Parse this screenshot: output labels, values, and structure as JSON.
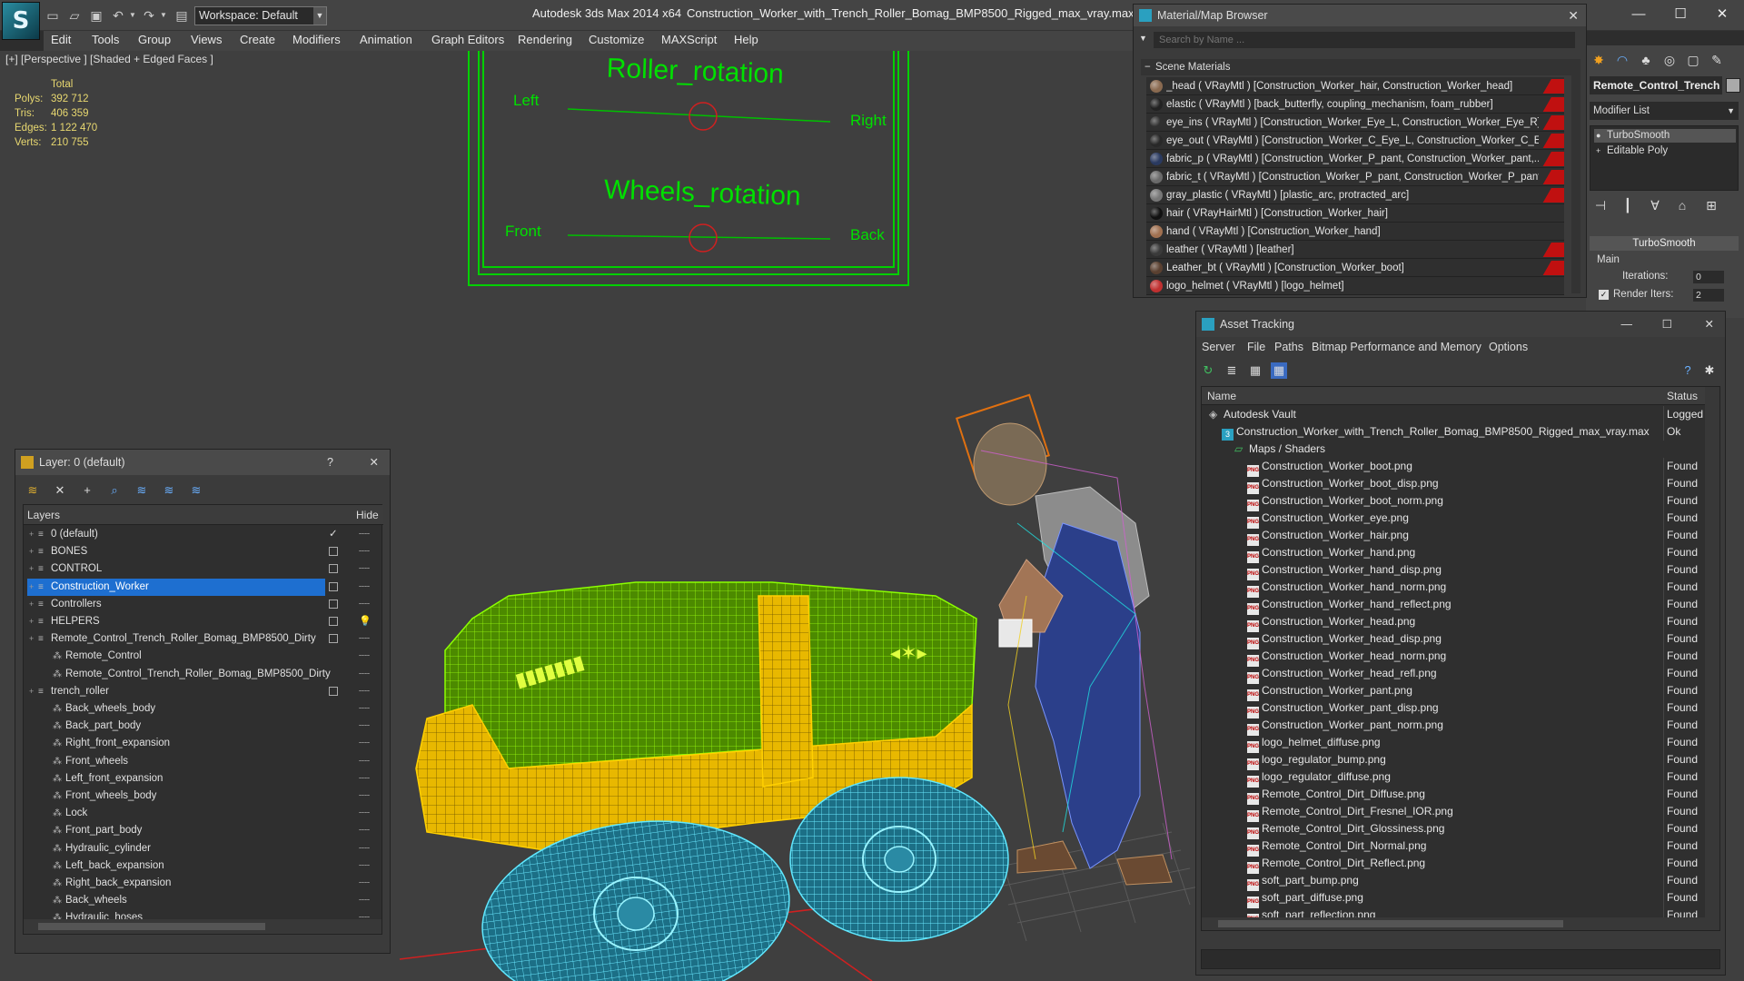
{
  "app": {
    "logo_glyph": "S",
    "title": "Autodesk 3ds Max  2014 x64",
    "file_title": "Construction_Worker_with_Trench_Roller_Bomag_BMP8500_Rigged_max_vray.max",
    "workspace": "Workspace: Default"
  },
  "menu": [
    "Edit",
    "Tools",
    "Group",
    "Views",
    "Create",
    "Modifiers",
    "Animation",
    "Graph Editors",
    "Rendering",
    "Customize",
    "MAXScript",
    "Help"
  ],
  "viewport": {
    "label": "[+] [Perspective ] [Shaded + Edged Faces ]",
    "stats": {
      "header": "Total",
      "rows": [
        {
          "k": "Polys:",
          "v": "392 712"
        },
        {
          "k": "Tris:",
          "v": "406 359"
        },
        {
          "k": "Edges:",
          "v": "1 122 470"
        },
        {
          "k": "Verts:",
          "v": "210 755"
        }
      ]
    },
    "controls": {
      "roller_title": "Roller_rotation",
      "roller_left": "Left",
      "roller_right": "Right",
      "wheels_title": "Wheels_rotation",
      "wheels_front": "Front",
      "wheels_back": "Back"
    }
  },
  "material_browser": {
    "title": "Material/Map Browser",
    "search_placeholder": "Search by Name ...",
    "section": "Scene Materials",
    "items": [
      {
        "text": "_head  ( VRayMtl ) [Construction_Worker_hair, Construction_Worker_head]",
        "color": "#8a6a50",
        "red": true
      },
      {
        "text": "elastic  ( VRayMtl ) [back_butterfly, coupling_mechanism, foam_rubber]",
        "color": "#222222",
        "red": true
      },
      {
        "text": "eye_ins  ( VRayMtl ) [Construction_Worker_Eye_L, Construction_Worker_Eye_R]",
        "color": "#303030",
        "red": true
      },
      {
        "text": "eye_out  ( VRayMtl ) [Construction_Worker_C_Eye_L, Construction_Worker_C_Ey...",
        "color": "#282828",
        "red": true
      },
      {
        "text": "fabric_p  ( VRayMtl ) [Construction_Worker_P_pant, Construction_Worker_pant,...",
        "color": "#2a3a60",
        "red": true
      },
      {
        "text": "fabric_t  ( VRayMtl ) [Construction_Worker_P_pant, Construction_Worker_P_pant...",
        "color": "#6a6a6a",
        "red": true
      },
      {
        "text": "gray_plastic  ( VRayMtl ) [plastic_arc, protracted_arc]",
        "color": "#777777",
        "red": true
      },
      {
        "text": "hair  ( VRayHairMtl ) [Construction_Worker_hair]",
        "color": "#111111",
        "red": false
      },
      {
        "text": "hand  ( VRayMtl ) [Construction_Worker_hand]",
        "color": "#a07050",
        "red": false
      },
      {
        "text": "leather  ( VRayMtl ) [leather]",
        "color": "#3a3a3a",
        "red": true
      },
      {
        "text": "Leather_bt  ( VRayMtl ) [Construction_Worker_boot]",
        "color": "#5a4030",
        "red": true
      },
      {
        "text": "logo_helmet  ( VRayMtl ) [logo_helmet]",
        "color": "#c03030",
        "red": false
      }
    ]
  },
  "command_panel": {
    "object_name": "Remote_Control_Trench",
    "modifier_list": "Modifier List",
    "stack": [
      "TurboSmooth",
      "Editable Poly"
    ],
    "rollout": "TurboSmooth",
    "main_label": "Main",
    "iterations_label": "Iterations:",
    "iterations_value": "0",
    "render_iters_label": "Render Iters:",
    "render_iters_value": "2"
  },
  "asset_tracking": {
    "title": "Asset Tracking",
    "menu": [
      "Server",
      "File",
      "Paths",
      "Bitmap Performance and Memory",
      "Options"
    ],
    "col_name": "Name",
    "col_status": "Status",
    "rows": [
      {
        "name": "Autodesk Vault",
        "status": "Logged",
        "indent": 0,
        "kind": "vault"
      },
      {
        "name": "Construction_Worker_with_Trench_Roller_Bomag_BMP8500_Rigged_max_vray.max",
        "status": "Ok",
        "indent": 1,
        "kind": "max"
      },
      {
        "name": "Maps / Shaders",
        "status": "",
        "indent": 2,
        "kind": "folder"
      },
      {
        "name": "Construction_Worker_boot.png",
        "status": "Found",
        "indent": 3,
        "kind": "png"
      },
      {
        "name": "Construction_Worker_boot_disp.png",
        "status": "Found",
        "indent": 3,
        "kind": "png"
      },
      {
        "name": "Construction_Worker_boot_norm.png",
        "status": "Found",
        "indent": 3,
        "kind": "png"
      },
      {
        "name": "Construction_Worker_eye.png",
        "status": "Found",
        "indent": 3,
        "kind": "png"
      },
      {
        "name": "Construction_Worker_hair.png",
        "status": "Found",
        "indent": 3,
        "kind": "png"
      },
      {
        "name": "Construction_Worker_hand.png",
        "status": "Found",
        "indent": 3,
        "kind": "png"
      },
      {
        "name": "Construction_Worker_hand_disp.png",
        "status": "Found",
        "indent": 3,
        "kind": "png"
      },
      {
        "name": "Construction_Worker_hand_norm.png",
        "status": "Found",
        "indent": 3,
        "kind": "png"
      },
      {
        "name": "Construction_Worker_hand_reflect.png",
        "status": "Found",
        "indent": 3,
        "kind": "png"
      },
      {
        "name": "Construction_Worker_head.png",
        "status": "Found",
        "indent": 3,
        "kind": "png"
      },
      {
        "name": "Construction_Worker_head_disp.png",
        "status": "Found",
        "indent": 3,
        "kind": "png"
      },
      {
        "name": "Construction_Worker_head_norm.png",
        "status": "Found",
        "indent": 3,
        "kind": "png"
      },
      {
        "name": "Construction_Worker_head_refl.png",
        "status": "Found",
        "indent": 3,
        "kind": "png"
      },
      {
        "name": "Construction_Worker_pant.png",
        "status": "Found",
        "indent": 3,
        "kind": "png"
      },
      {
        "name": "Construction_Worker_pant_disp.png",
        "status": "Found",
        "indent": 3,
        "kind": "png"
      },
      {
        "name": "Construction_Worker_pant_norm.png",
        "status": "Found",
        "indent": 3,
        "kind": "png"
      },
      {
        "name": "logo_helmet_diffuse.png",
        "status": "Found",
        "indent": 3,
        "kind": "png"
      },
      {
        "name": "logo_regulator_bump.png",
        "status": "Found",
        "indent": 3,
        "kind": "png"
      },
      {
        "name": "logo_regulator_diffuse.png",
        "status": "Found",
        "indent": 3,
        "kind": "png"
      },
      {
        "name": "Remote_Control_Dirt_Diffuse.png",
        "status": "Found",
        "indent": 3,
        "kind": "png"
      },
      {
        "name": "Remote_Control_Dirt_Fresnel_IOR.png",
        "status": "Found",
        "indent": 3,
        "kind": "png"
      },
      {
        "name": "Remote_Control_Dirt_Glossiness.png",
        "status": "Found",
        "indent": 3,
        "kind": "png"
      },
      {
        "name": "Remote_Control_Dirt_Normal.png",
        "status": "Found",
        "indent": 3,
        "kind": "png"
      },
      {
        "name": "Remote_Control_Dirt_Reflect.png",
        "status": "Found",
        "indent": 3,
        "kind": "png"
      },
      {
        "name": "soft_part_bump.png",
        "status": "Found",
        "indent": 3,
        "kind": "png"
      },
      {
        "name": "soft_part_diffuse.png",
        "status": "Found",
        "indent": 3,
        "kind": "png"
      },
      {
        "name": "soft_part_reflection.png",
        "status": "Found",
        "indent": 3,
        "kind": "png"
      }
    ]
  },
  "layer_explorer": {
    "title": "Layer: 0 (default)",
    "help": "?",
    "col_layers": "Layers",
    "col_hide": "Hide",
    "rows": [
      {
        "name": "0 (default)",
        "indent": 0,
        "kind": "layer",
        "check": "tick",
        "selected": false
      },
      {
        "name": "BONES",
        "indent": 0,
        "kind": "layer",
        "check": "box",
        "selected": false
      },
      {
        "name": "CONTROL",
        "indent": 0,
        "kind": "layer",
        "check": "box",
        "selected": false
      },
      {
        "name": "Construction_Worker",
        "indent": 0,
        "kind": "layer",
        "check": "box",
        "selected": true
      },
      {
        "name": "Controllers",
        "indent": 0,
        "kind": "layer",
        "check": "box",
        "selected": false
      },
      {
        "name": "HELPERS",
        "indent": 0,
        "kind": "layer",
        "check": "box",
        "selected": false,
        "bulb": true
      },
      {
        "name": "Remote_Control_Trench_Roller_Bomag_BMP8500_Dirty",
        "indent": 0,
        "kind": "layer",
        "check": "box",
        "selected": false
      },
      {
        "name": "Remote_Control",
        "indent": 1,
        "kind": "object",
        "check": "",
        "selected": false
      },
      {
        "name": "Remote_Control_Trench_Roller_Bomag_BMP8500_Dirty",
        "indent": 1,
        "kind": "object",
        "check": "",
        "selected": false
      },
      {
        "name": "trench_roller",
        "indent": 0,
        "kind": "layer",
        "check": "box",
        "selected": false
      },
      {
        "name": "Back_wheels_body",
        "indent": 1,
        "kind": "object",
        "check": "",
        "selected": false
      },
      {
        "name": "Back_part_body",
        "indent": 1,
        "kind": "object",
        "check": "",
        "selected": false
      },
      {
        "name": "Right_front_expansion",
        "indent": 1,
        "kind": "object",
        "check": "",
        "selected": false
      },
      {
        "name": "Front_wheels",
        "indent": 1,
        "kind": "object",
        "check": "",
        "selected": false
      },
      {
        "name": "Left_front_expansion",
        "indent": 1,
        "kind": "object",
        "check": "",
        "selected": false
      },
      {
        "name": "Front_wheels_body",
        "indent": 1,
        "kind": "object",
        "check": "",
        "selected": false
      },
      {
        "name": "Lock",
        "indent": 1,
        "kind": "object",
        "check": "",
        "selected": false
      },
      {
        "name": "Front_part_body",
        "indent": 1,
        "kind": "object",
        "check": "",
        "selected": false
      },
      {
        "name": "Hydraulic_cylinder",
        "indent": 1,
        "kind": "object",
        "check": "",
        "selected": false
      },
      {
        "name": "Left_back_expansion",
        "indent": 1,
        "kind": "object",
        "check": "",
        "selected": false
      },
      {
        "name": "Right_back_expansion",
        "indent": 1,
        "kind": "object",
        "check": "",
        "selected": false
      },
      {
        "name": "Back_wheels",
        "indent": 1,
        "kind": "object",
        "check": "",
        "selected": false
      },
      {
        "name": "Hydraulic_hoses",
        "indent": 1,
        "kind": "object",
        "check": "",
        "selected": false
      }
    ]
  },
  "colors": {
    "viewport_bg": "#3f3f3f",
    "wire_green": "#6fd000",
    "wire_yellow": "#f0c000",
    "wire_cyan": "#40d8f0",
    "control_green": "#00e000",
    "selection_blue": "#1e6fd0",
    "stats_yellow": "#e8d870"
  }
}
